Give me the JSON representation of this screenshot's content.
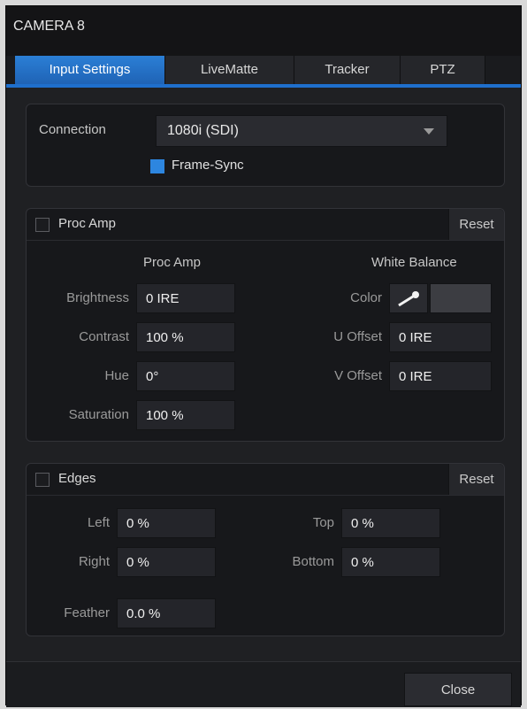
{
  "window": {
    "title": "CAMERA 8"
  },
  "tabs": [
    {
      "label": "Input Settings",
      "active": true
    },
    {
      "label": "LiveMatte",
      "active": false
    },
    {
      "label": "Tracker",
      "active": false
    },
    {
      "label": "PTZ",
      "active": false
    }
  ],
  "connection": {
    "label": "Connection",
    "value": "1080i (SDI)",
    "frame_sync_label": "Frame-Sync",
    "frame_sync_checked": true
  },
  "proc_amp": {
    "section_label": "Proc Amp",
    "enabled": false,
    "reset_label": "Reset",
    "column_header": "Proc Amp",
    "brightness_label": "Brightness",
    "brightness_value": "0 IRE",
    "contrast_label": "Contrast",
    "contrast_value": "100 %",
    "hue_label": "Hue",
    "hue_value": "0°",
    "saturation_label": "Saturation",
    "saturation_value": "100 %",
    "white_balance_header": "White Balance",
    "color_label": "Color",
    "u_offset_label": "U Offset",
    "u_offset_value": "0 IRE",
    "v_offset_label": "V Offset",
    "v_offset_value": "0 IRE"
  },
  "edges": {
    "section_label": "Edges",
    "enabled": false,
    "reset_label": "Reset",
    "left_label": "Left",
    "left_value": "0 %",
    "right_label": "Right",
    "right_value": "0 %",
    "top_label": "Top",
    "top_value": "0 %",
    "bottom_label": "Bottom",
    "bottom_value": "0 %",
    "feather_label": "Feather",
    "feather_value": "0.0 %"
  },
  "footer": {
    "close_label": "Close"
  },
  "colors": {
    "accent": "#1f6fcc",
    "checkbox_checked": "#2d86e0"
  },
  "icons": {
    "dropdown": "chevron-down-icon",
    "eyedropper": "eyedropper-icon"
  }
}
